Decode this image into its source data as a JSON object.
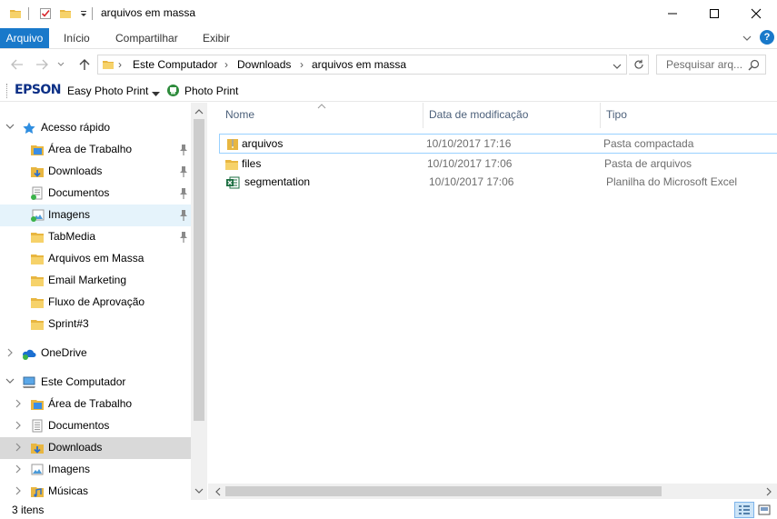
{
  "window": {
    "title": "arquivos em massa",
    "minimize_symbol": "—",
    "maximize_symbol": "☐",
    "close_symbol": "✕"
  },
  "ribbon": {
    "tabs": [
      "Arquivo",
      "Início",
      "Compartilhar",
      "Exibir"
    ],
    "help_symbol": "?"
  },
  "address": {
    "crumbs": [
      "Este Computador",
      "Downloads",
      "arquivos em massa"
    ],
    "search_placeholder": "Pesquisar arq..."
  },
  "toolbar": {
    "brand": "EPSON",
    "easy_photo_print": "Easy Photo Print",
    "photo_print": "Photo Print"
  },
  "nav": {
    "quick_access": "Acesso rápido",
    "quick_items": [
      {
        "label": "Área de Trabalho",
        "icon": "desktop-folder-icon",
        "pinned": true
      },
      {
        "label": "Downloads",
        "icon": "downloads-folder-icon",
        "pinned": true
      },
      {
        "label": "Documentos",
        "icon": "documents-folder-icon",
        "pinned": true
      },
      {
        "label": "Imagens",
        "icon": "pictures-folder-icon",
        "pinned": true
      },
      {
        "label": "TabMedia",
        "icon": "folder-icon",
        "pinned": true
      },
      {
        "label": "Arquivos em Massa",
        "icon": "folder-icon",
        "pinned": false
      },
      {
        "label": "Email Marketing",
        "icon": "folder-icon",
        "pinned": false
      },
      {
        "label": "Fluxo de Aprovação",
        "icon": "folder-icon",
        "pinned": false
      },
      {
        "label": "Sprint#3",
        "icon": "folder-icon",
        "pinned": false
      }
    ],
    "onedrive": "OneDrive",
    "this_pc": "Este Computador",
    "pc_items": [
      {
        "label": "Área de Trabalho",
        "icon": "desktop-folder-icon"
      },
      {
        "label": "Documentos",
        "icon": "documents-folder-icon"
      },
      {
        "label": "Downloads",
        "icon": "downloads-folder-icon"
      },
      {
        "label": "Imagens",
        "icon": "pictures-folder-icon"
      },
      {
        "label": "Músicas",
        "icon": "music-folder-icon"
      }
    ]
  },
  "columns": {
    "name": "Nome",
    "date": "Data de modificação",
    "type": "Tipo"
  },
  "files": [
    {
      "name": "arquivos",
      "date": "10/10/2017 17:16",
      "type": "Pasta compactada",
      "icon": "zip-folder-icon"
    },
    {
      "name": "files",
      "date": "10/10/2017 17:06",
      "type": "Pasta de arquivos",
      "icon": "folder-icon"
    },
    {
      "name": "segmentation",
      "date": "10/10/2017 17:06",
      "type": "Planilha do Microsoft Excel",
      "icon": "excel-file-icon"
    }
  ],
  "status": {
    "item_count": "3 itens"
  },
  "colors": {
    "accent": "#1979ca",
    "folder": "#e8b640",
    "selected": "#e5f3fb",
    "hover": "#d9d9d9"
  }
}
